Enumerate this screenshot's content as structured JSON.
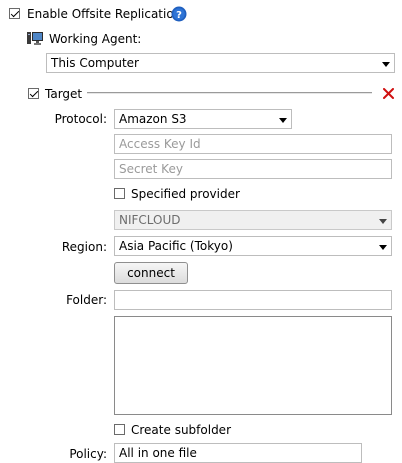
{
  "offsite": {
    "label": "Enable Offsite Replication",
    "checked": true
  },
  "agent": {
    "label": "Working Agent:",
    "value": "This Computer"
  },
  "target": {
    "label": "Target",
    "checked": true
  },
  "protocol": {
    "label": "Protocol:",
    "value": "Amazon S3"
  },
  "access_key": {
    "placeholder": "Access Key Id"
  },
  "secret_key": {
    "placeholder": "Secret Key"
  },
  "specified_provider": {
    "label": "Specified provider",
    "checked": false
  },
  "provider": {
    "value": "NIFCLOUD"
  },
  "region": {
    "label": "Region:",
    "value": "Asia Pacific (Tokyo)"
  },
  "connect": {
    "label": "connect"
  },
  "folder": {
    "label": "Folder:",
    "value": ""
  },
  "create_subfolder": {
    "label": "Create subfolder",
    "checked": false
  },
  "policy": {
    "label": "Policy:",
    "value": "All in one file"
  },
  "colors": {
    "help_blue": "#1f5fbf",
    "remove_red": "#d01010",
    "separator": "#9a9a9a"
  }
}
